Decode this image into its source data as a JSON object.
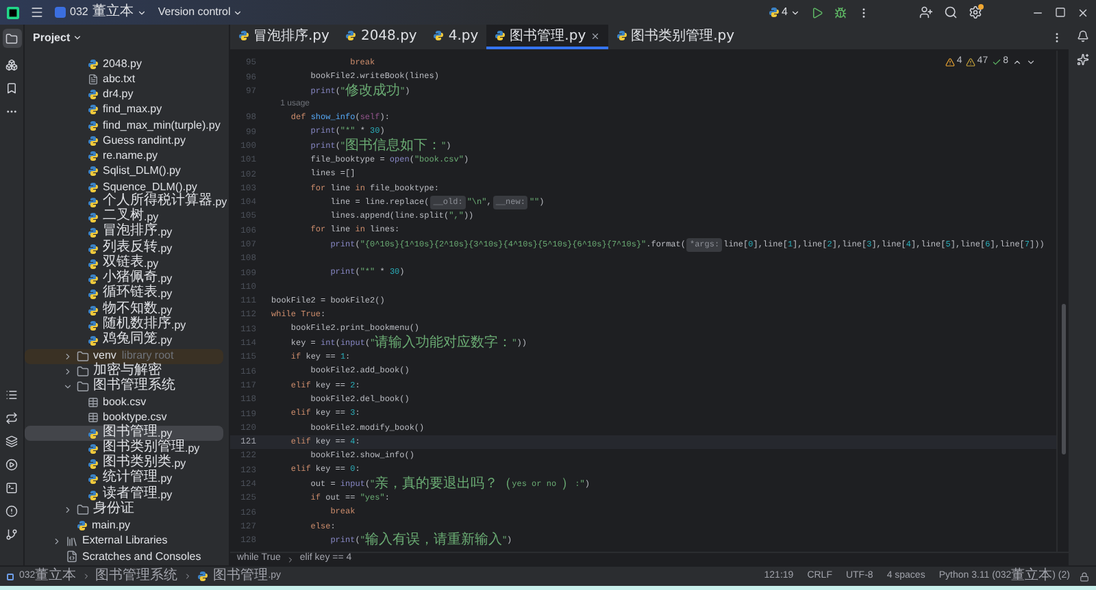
{
  "topbar": {
    "project": "032董立本",
    "vcs": "Version control",
    "run_config": "4"
  },
  "tool_window": {
    "title": "Project"
  },
  "tabs": [
    {
      "label": "冒泡排序.py",
      "selected": false
    },
    {
      "label": "2048.py",
      "selected": false
    },
    {
      "label": "4.py",
      "selected": false
    },
    {
      "label": "图书管理.py",
      "selected": true
    },
    {
      "label": "图书类别管理.py",
      "selected": false
    }
  ],
  "tree": {
    "files_above": [
      {
        "label": "2048.py",
        "kind": "py",
        "selected": false
      },
      {
        "label": "abc.txt",
        "kind": "txt",
        "selected": false
      },
      {
        "label": "dr4.py",
        "kind": "py",
        "selected": false
      },
      {
        "label": "find_max.py",
        "kind": "py",
        "selected": false
      },
      {
        "label": "find_max_min(turple).py",
        "kind": "py",
        "selected": false
      },
      {
        "label": "Guess randint.py",
        "kind": "py",
        "selected": false
      },
      {
        "label": "re.name.py",
        "kind": "py",
        "selected": false
      },
      {
        "label": "Sqlist_DLM().py",
        "kind": "py",
        "selected": false
      },
      {
        "label": "Squence_DLM().py",
        "kind": "py",
        "selected": false
      },
      {
        "label": "个人所得税计算器.py",
        "kind": "py",
        "selected": false
      },
      {
        "label": "二叉树.py",
        "kind": "py",
        "selected": false
      },
      {
        "label": "冒泡排序.py",
        "kind": "py",
        "selected": false
      },
      {
        "label": "列表反转.py",
        "kind": "py",
        "selected": false
      },
      {
        "label": "双链表.py",
        "kind": "py",
        "selected": false
      },
      {
        "label": "小猪佩奇.py",
        "kind": "py",
        "selected": false
      },
      {
        "label": "循环链表.py",
        "kind": "py",
        "selected": false
      },
      {
        "label": "物不知数.py",
        "kind": "py",
        "selected": false
      },
      {
        "label": "随机数排序.py",
        "kind": "py",
        "selected": false
      },
      {
        "label": "鸡兔同笼.py",
        "kind": "py",
        "selected": false
      }
    ],
    "folder_items": [
      {
        "label": "venv",
        "note": "library root",
        "kind": "library",
        "expanded": false,
        "selected": false
      },
      {
        "label": "加密与解密",
        "kind": "folder",
        "expanded": false,
        "selected": false
      },
      {
        "label": "图书管理系统",
        "kind": "folder",
        "expanded": true,
        "selected": false,
        "children": [
          {
            "label": "book.csv",
            "kind": "csv",
            "selected": false
          },
          {
            "label": "booktype.csv",
            "kind": "csv",
            "selected": false
          },
          {
            "label": "图书管理.py",
            "kind": "py",
            "selected": true
          },
          {
            "label": "图书类别管理.py",
            "kind": "py",
            "selected": false
          },
          {
            "label": "图书类别类.py",
            "kind": "py",
            "selected": false
          },
          {
            "label": "统计管理.py",
            "kind": "py",
            "selected": false
          },
          {
            "label": "读者管理.py",
            "kind": "py",
            "selected": false
          }
        ]
      },
      {
        "label": "身份证",
        "kind": "folder",
        "expanded": false,
        "selected": false
      },
      {
        "label": "main.py",
        "kind": "py",
        "selected": false
      }
    ],
    "root_items": [
      {
        "label": "External Libraries",
        "kind": "libs",
        "expanded": false,
        "selected": false
      },
      {
        "label": "Scratches and Consoles",
        "kind": "scratches",
        "selected": false
      }
    ]
  },
  "inspections": {
    "warnings": "4",
    "weak_warnings": "47",
    "ok": "8"
  },
  "code": [
    {
      "no": "95",
      "current": false,
      "tokens": [
        {
          "kind": "k",
          "text": "                break"
        }
      ]
    },
    {
      "no": "96",
      "current": false,
      "tokens": [
        {
          "kind": "p",
          "text": "        bookFile2.writeBook(lines)"
        }
      ]
    },
    {
      "no": "97",
      "current": false,
      "tokens": [
        {
          "kind": "b",
          "text": "        print"
        },
        {
          "kind": "p",
          "text": "("
        },
        {
          "kind": "s",
          "text": "\"修改成功\""
        },
        {
          "kind": "p",
          "text": ")"
        }
      ]
    },
    {
      "kind": "usage",
      "tokens": [
        {
          "kind": "u",
          "text": "    1 usage"
        }
      ]
    },
    {
      "no": "98",
      "current": false,
      "tokens": [
        {
          "kind": "k",
          "text": "    def "
        },
        {
          "kind": "f",
          "text": "show_info"
        },
        {
          "kind": "p",
          "text": "("
        },
        {
          "kind": "v",
          "text": "self"
        },
        {
          "kind": "p",
          "text": "):"
        }
      ]
    },
    {
      "no": "99",
      "current": false,
      "tokens": [
        {
          "kind": "b",
          "text": "        print"
        },
        {
          "kind": "p",
          "text": "("
        },
        {
          "kind": "s",
          "text": "\"*\""
        },
        {
          "kind": "p",
          "text": " * "
        },
        {
          "kind": "n",
          "text": "30"
        },
        {
          "kind": "p",
          "text": ")"
        }
      ]
    },
    {
      "no": "100",
      "current": false,
      "tokens": [
        {
          "kind": "b",
          "text": "        print"
        },
        {
          "kind": "p",
          "text": "("
        },
        {
          "kind": "s",
          "text": "\"图书信息如下：\""
        },
        {
          "kind": "p",
          "text": ")"
        }
      ]
    },
    {
      "no": "101",
      "current": false,
      "tokens": [
        {
          "kind": "p",
          "text": "        file_booktype = "
        },
        {
          "kind": "b",
          "text": "open"
        },
        {
          "kind": "p",
          "text": "("
        },
        {
          "kind": "s",
          "text": "\"book.csv\""
        },
        {
          "kind": "p",
          "text": ")"
        }
      ]
    },
    {
      "no": "102",
      "current": false,
      "tokens": [
        {
          "kind": "p",
          "text": "        lines =[]"
        }
      ]
    },
    {
      "no": "103",
      "current": false,
      "tokens": [
        {
          "kind": "k",
          "text": "        for "
        },
        {
          "kind": "p",
          "text": "line "
        },
        {
          "kind": "k",
          "text": "in "
        },
        {
          "kind": "p",
          "text": "file_booktype:"
        }
      ]
    },
    {
      "no": "104",
      "current": false,
      "tokens": [
        {
          "kind": "p",
          "text": "            line = line.replace("
        },
        {
          "kind": "h",
          "text": "__old:"
        },
        {
          "kind": "s",
          "text": "\"\\n\""
        },
        {
          "kind": "p",
          "text": ","
        },
        {
          "kind": "h",
          "text": "__new:"
        },
        {
          "kind": "s",
          "text": "\"\""
        },
        {
          "kind": "p",
          "text": ")"
        }
      ]
    },
    {
      "no": "105",
      "current": false,
      "tokens": [
        {
          "kind": "p",
          "text": "            lines.append(line.split("
        },
        {
          "kind": "s",
          "text": "\",\""
        },
        {
          "kind": "p",
          "text": "))"
        }
      ]
    },
    {
      "no": "106",
      "current": false,
      "tokens": [
        {
          "kind": "k",
          "text": "        for "
        },
        {
          "kind": "p",
          "text": "line "
        },
        {
          "kind": "k",
          "text": "in "
        },
        {
          "kind": "p",
          "text": "lines:"
        }
      ]
    },
    {
      "no": "107",
      "current": false,
      "tokens": [
        {
          "kind": "b",
          "text": "            print"
        },
        {
          "kind": "p",
          "text": "("
        },
        {
          "kind": "s",
          "text": "\"{0^10s}{1^10s}{2^10s}{3^10s}{4^10s}{5^10s}{6^10s}{7^10s}\""
        },
        {
          "kind": "p",
          "text": ".format("
        },
        {
          "kind": "h",
          "text": "*args:"
        },
        {
          "kind": "p",
          "text": "line["
        },
        {
          "kind": "n",
          "text": "0"
        },
        {
          "kind": "p",
          "text": "],line["
        },
        {
          "kind": "n",
          "text": "1"
        },
        {
          "kind": "p",
          "text": "],line["
        },
        {
          "kind": "n",
          "text": "2"
        },
        {
          "kind": "p",
          "text": "],line["
        },
        {
          "kind": "n",
          "text": "3"
        },
        {
          "kind": "p",
          "text": "],line["
        },
        {
          "kind": "n",
          "text": "4"
        },
        {
          "kind": "p",
          "text": "],line["
        },
        {
          "kind": "n",
          "text": "5"
        },
        {
          "kind": "p",
          "text": "],line["
        },
        {
          "kind": "n",
          "text": "6"
        },
        {
          "kind": "p",
          "text": "],line["
        },
        {
          "kind": "n",
          "text": "7"
        },
        {
          "kind": "p",
          "text": "]))"
        }
      ]
    },
    {
      "no": "108",
      "current": false
    },
    {
      "no": "109",
      "current": false,
      "tokens": [
        {
          "kind": "b",
          "text": "            print"
        },
        {
          "kind": "p",
          "text": "("
        },
        {
          "kind": "s",
          "text": "\"*\""
        },
        {
          "kind": "p",
          "text": " * "
        },
        {
          "kind": "n",
          "text": "30"
        },
        {
          "kind": "p",
          "text": ")"
        }
      ]
    },
    {
      "no": "110",
      "current": false
    },
    {
      "no": "111",
      "current": false,
      "tokens": [
        {
          "kind": "p",
          "text": "bookFile2 = bookFile2()"
        }
      ]
    },
    {
      "no": "112",
      "current": false,
      "tokens": [
        {
          "kind": "k",
          "text": "while "
        },
        {
          "kind": "k",
          "text": "True"
        },
        {
          "kind": "p",
          "text": ":"
        }
      ]
    },
    {
      "no": "113",
      "current": false,
      "tokens": [
        {
          "kind": "p",
          "text": "    bookFile2.print_bookmenu()"
        }
      ]
    },
    {
      "no": "114",
      "current": false,
      "tokens": [
        {
          "kind": "p",
          "text": "    key = "
        },
        {
          "kind": "b",
          "text": "int"
        },
        {
          "kind": "p",
          "text": "("
        },
        {
          "kind": "b",
          "text": "input"
        },
        {
          "kind": "p",
          "text": "("
        },
        {
          "kind": "s",
          "text": "\"请输入功能对应数字：\""
        },
        {
          "kind": "p",
          "text": "))"
        }
      ]
    },
    {
      "no": "115",
      "current": false,
      "tokens": [
        {
          "kind": "k",
          "text": "    if "
        },
        {
          "kind": "p",
          "text": "key == "
        },
        {
          "kind": "n",
          "text": "1"
        },
        {
          "kind": "p",
          "text": ":"
        }
      ]
    },
    {
      "no": "116",
      "current": false,
      "tokens": [
        {
          "kind": "p",
          "text": "        bookFile2.add_book()"
        }
      ]
    },
    {
      "no": "117",
      "current": false,
      "tokens": [
        {
          "kind": "k",
          "text": "    elif "
        },
        {
          "kind": "p",
          "text": "key == "
        },
        {
          "kind": "n",
          "text": "2"
        },
        {
          "kind": "p",
          "text": ":"
        }
      ]
    },
    {
      "no": "118",
      "current": false,
      "tokens": [
        {
          "kind": "p",
          "text": "        bookFile2.del_book()"
        }
      ]
    },
    {
      "no": "119",
      "current": false,
      "tokens": [
        {
          "kind": "k",
          "text": "    elif "
        },
        {
          "kind": "p",
          "text": "key == "
        },
        {
          "kind": "n",
          "text": "3"
        },
        {
          "kind": "p",
          "text": ":"
        }
      ]
    },
    {
      "no": "120",
      "current": false,
      "tokens": [
        {
          "kind": "p",
          "text": "        bookFile2.modify_book()"
        }
      ]
    },
    {
      "no": "121",
      "current": true,
      "tokens": [
        {
          "kind": "k",
          "text": "    elif "
        },
        {
          "kind": "p",
          "text": "key == "
        },
        {
          "kind": "n",
          "text": "4"
        },
        {
          "kind": "p",
          "text": ":"
        }
      ]
    },
    {
      "no": "122",
      "current": false,
      "tokens": [
        {
          "kind": "p",
          "text": "        bookFile2.show_info()"
        }
      ]
    },
    {
      "no": "123",
      "current": false,
      "tokens": [
        {
          "kind": "k",
          "text": "    elif "
        },
        {
          "kind": "p",
          "text": "key == "
        },
        {
          "kind": "n",
          "text": "0"
        },
        {
          "kind": "p",
          "text": ":"
        }
      ]
    },
    {
      "no": "124",
      "current": false,
      "tokens": [
        {
          "kind": "p",
          "text": "        out = "
        },
        {
          "kind": "b",
          "text": "input"
        },
        {
          "kind": "p",
          "text": "("
        },
        {
          "kind": "s",
          "text": "\"亲，真的要退出吗？（yes or no ）:\""
        },
        {
          "kind": "p",
          "text": ")"
        }
      ]
    },
    {
      "no": "125",
      "current": false,
      "tokens": [
        {
          "kind": "k",
          "text": "        if "
        },
        {
          "kind": "p",
          "text": "out == "
        },
        {
          "kind": "s",
          "text": "\"yes\""
        },
        {
          "kind": "p",
          "text": ":"
        }
      ]
    },
    {
      "no": "126",
      "current": false,
      "tokens": [
        {
          "kind": "k",
          "text": "            break"
        }
      ]
    },
    {
      "no": "127",
      "current": false,
      "tokens": [
        {
          "kind": "k",
          "text": "        else"
        },
        {
          "kind": "p",
          "text": ":"
        }
      ]
    },
    {
      "no": "128",
      "current": false,
      "tokens": [
        {
          "kind": "b",
          "text": "            print"
        },
        {
          "kind": "p",
          "text": "("
        },
        {
          "kind": "s",
          "text": "\"输入有误，请重新输入\""
        },
        {
          "kind": "p",
          "text": ")"
        }
      ]
    }
  ],
  "breadcrumb": [
    "while True",
    "elif key == 4"
  ],
  "status": {
    "path": [
      "032董立本",
      "图书管理系统",
      "图书管理.py"
    ],
    "items": [
      "121:19",
      "CRLF",
      "UTF-8",
      "4 spaces",
      "Python 3.11 (032董立本) (2)"
    ]
  }
}
